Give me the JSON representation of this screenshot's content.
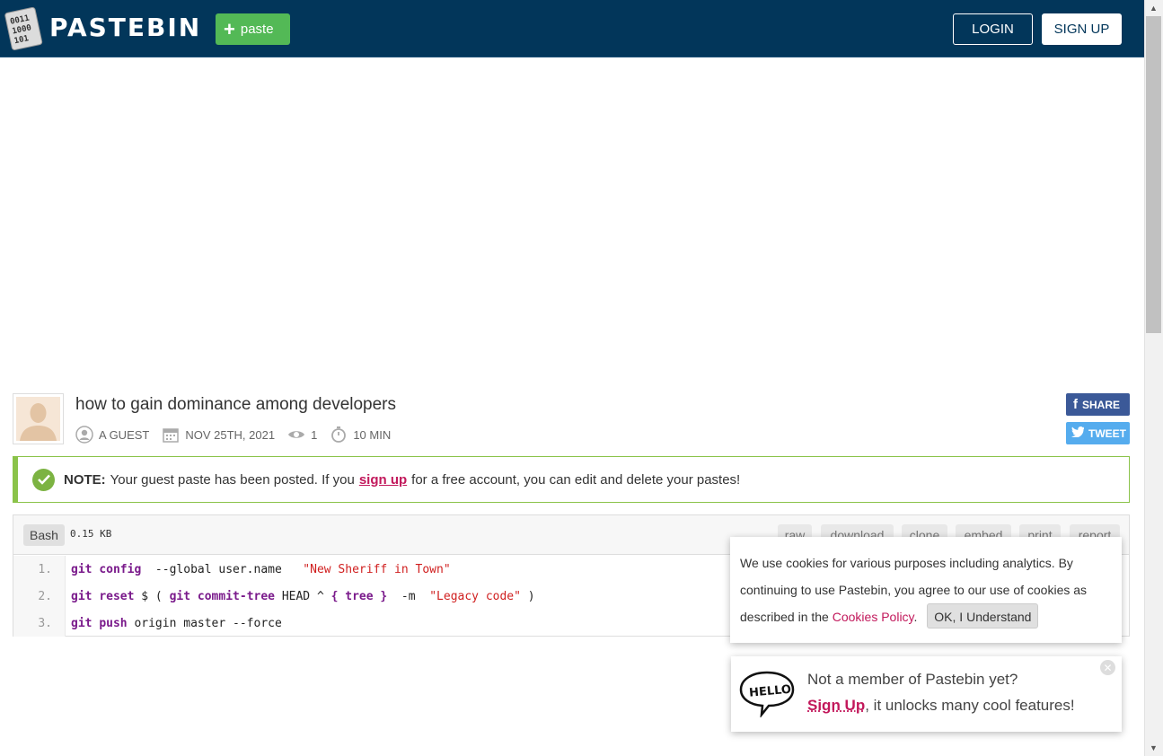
{
  "header": {
    "logo_text": "PASTEBIN",
    "paste_label": "paste",
    "login_label": "LOGIN",
    "signup_label": "SIGN UP",
    "bg_color": "#02365a",
    "paste_color": "#53b956"
  },
  "paste": {
    "title": "how to gain dominance among developers",
    "author": "A GUEST",
    "date": "NOV 25TH, 2021",
    "views": "1",
    "expire": "10 MIN"
  },
  "social": {
    "share_label": "SHARE",
    "tweet_label": "TWEET"
  },
  "note": {
    "label": "NOTE:",
    "text_before": "Your guest paste has been posted. If you",
    "link": "sign up",
    "text_after": "for a free account, you can edit and delete your pastes!"
  },
  "code": {
    "language": "Bash",
    "size": "0.15 KB",
    "tools": [
      "raw",
      "download",
      "clone",
      "embed",
      "print",
      "report"
    ],
    "line_numbers": [
      "1.",
      "2.",
      "3."
    ]
  },
  "cookie": {
    "text1": "We use cookies for various purposes including analytics. By continuing to use Pastebin, you agree to our use of cookies as described in the",
    "link": "Cookies Policy",
    "period": ".",
    "button": "OK, I Understand"
  },
  "hello": {
    "line1": "Not a member of Pastebin yet?",
    "link": "Sign Up",
    "line2_rest": ", it unlocks many cool features!"
  }
}
